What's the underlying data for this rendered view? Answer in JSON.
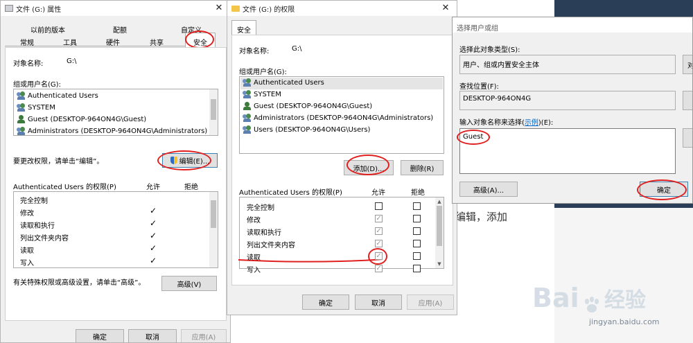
{
  "props": {
    "title": "文件 (G:) 属性",
    "tabs_row1": [
      "以前的版本",
      "配额",
      "自定义"
    ],
    "tabs_row2": [
      "常规",
      "工具",
      "硬件",
      "共享",
      "安全"
    ],
    "object_label": "对象名称:",
    "object_value": "G:\\",
    "group_label": "组或用户名(G):",
    "users": [
      "Authenticated Users",
      "SYSTEM",
      "Guest (DESKTOP-964ON4G\\Guest)",
      "Administrators (DESKTOP-964ON4G\\Administrators)"
    ],
    "edit_hint": "要更改权限，请单击“编辑”。",
    "edit_button": "编辑(E)...",
    "perm_header": "Authenticated Users 的权限(P)",
    "allow": "允许",
    "deny": "拒绝",
    "perms": [
      "完全控制",
      "修改",
      "读取和执行",
      "列出文件夹内容",
      "读取",
      "写入"
    ],
    "allowed": [
      false,
      true,
      true,
      true,
      true,
      true
    ],
    "check_mark": "✓",
    "adv_hint": "有关特殊权限或高级设置，请单击“高级”。",
    "adv_button": "高级(V)",
    "ok": "确定",
    "cancel": "取消",
    "apply": "应用(A)"
  },
  "perm": {
    "title": "文件 (G:) 的权限",
    "tab": "安全",
    "object_label": "对象名称:",
    "object_value": "G:\\",
    "group_label": "组或用户名(G):",
    "users": [
      "Authenticated Users",
      "SYSTEM",
      "Guest (DESKTOP-964ON4G\\Guest)",
      "Administrators (DESKTOP-964ON4G\\Administrators)",
      "Users (DESKTOP-964ON4G\\Users)"
    ],
    "add_button": "添加(D)...",
    "remove_button": "删除(R)",
    "perm_header": "Authenticated Users 的权限(P)",
    "allow": "允许",
    "deny": "拒绝",
    "perms": [
      "完全控制",
      "修改",
      "读取和执行",
      "列出文件夹内容",
      "读取",
      "写入"
    ],
    "allowed": [
      false,
      true,
      true,
      true,
      true,
      true
    ],
    "ok": "确定",
    "cancel": "取消",
    "apply": "应用(A)"
  },
  "select": {
    "title": "选择用户或组",
    "type_label": "选择此对象类型(S):",
    "type_value": "用户、组或内置安全主体",
    "type_button": "对",
    "loc_label": "查找位置(F):",
    "loc_value": "DESKTOP-964ON4G",
    "enter_label_pre": "输入对象名称来选择(",
    "enter_link": "示例",
    "enter_label_post": ")(E):",
    "input_value": "Guest",
    "adv_button": "高级(A)...",
    "ok": "确定"
  },
  "background": {
    "text": "编辑，添加",
    "watermark": "Bai",
    "watermark2": "经验",
    "watermark_url": "jingyan.baidu.com"
  },
  "colors": {
    "annotation_red": "#e0201f",
    "link_blue": "#0066cc"
  }
}
